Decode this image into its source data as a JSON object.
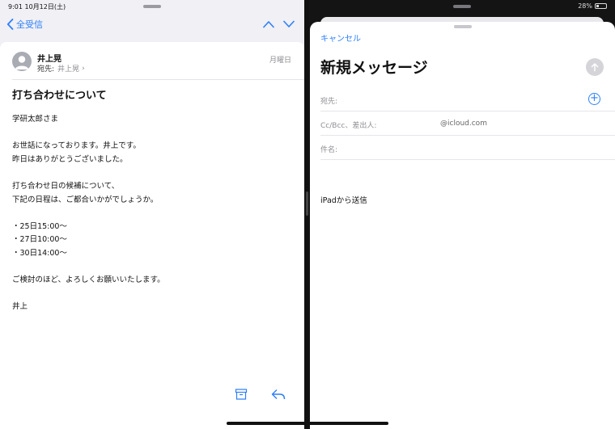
{
  "status_bar": {
    "time_date": "9:01 10月12日(土)",
    "battery": "28%"
  },
  "mail_nav": {
    "back_label": "全受信"
  },
  "message": {
    "sender": "井上晃",
    "recipient_label": "宛先:",
    "recipient": "井上晃",
    "date": "月曜日",
    "subject": "打ち合わせについて",
    "body_lines": [
      "学研太郎さま",
      "",
      "お世話になっております。井上です。",
      "昨日はありがとうございました。",
      "",
      "打ち合わせ日の候補について、",
      "下記の日程は、ご都合いかがでしょうか。",
      "",
      "・25日15:00〜",
      "・27日10:00〜",
      "・30日14:00〜",
      "",
      "ご検討のほど、よろしくお願いいたします。",
      "",
      "井上"
    ]
  },
  "compose": {
    "cancel_label": "キャンセル",
    "title": "新規メッセージ",
    "to_label": "宛先:",
    "cc_label": "Cc/Bcc、差出人:",
    "cc_value": "@icloud.com",
    "subject_label": "件名:",
    "signature": "iPadから送信"
  },
  "icons": {
    "back": "chevron-left-icon",
    "up": "chevron-up-icon",
    "down": "chevron-down-icon",
    "avatar": "person-icon",
    "archive": "archive-box-icon",
    "reply": "reply-arrow-icon",
    "send": "arrow-up-icon",
    "add": "plus-circle-icon"
  },
  "colors": {
    "accent": "#2d7ff9",
    "secondary_text": "#8e8e93",
    "send_disabled": "#d5d5d9"
  }
}
